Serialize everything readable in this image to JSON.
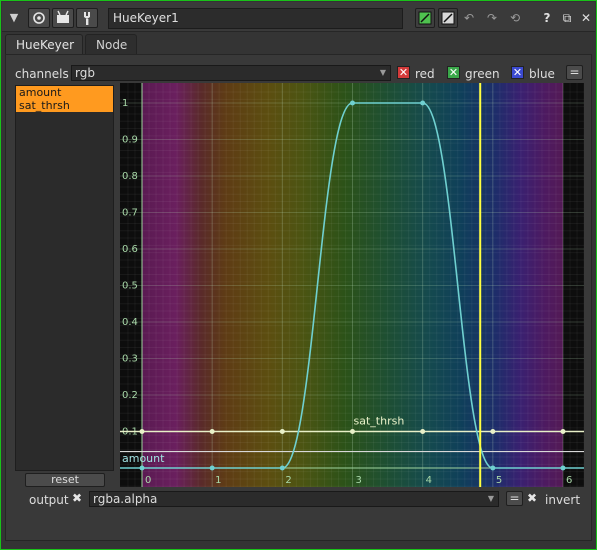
{
  "titlebar": {
    "node_name": "HueKeyer1",
    "help_label": "?",
    "float_label": "⧉",
    "close_label": "✕"
  },
  "tabs": [
    {
      "label": "HueKeyer",
      "active": true
    },
    {
      "label": "Node",
      "active": false
    }
  ],
  "channels": {
    "label": "channels",
    "value": "rgb",
    "red": {
      "label": "red",
      "checked": true,
      "color": "#d43a3a"
    },
    "green": {
      "label": "green",
      "checked": true,
      "color": "#3aa84a"
    },
    "blue": {
      "label": "blue",
      "checked": true,
      "color": "#3b4ad0"
    },
    "link_label": "="
  },
  "curves": [
    "amount",
    "sat_thrsh"
  ],
  "curve_highlight_color": "#ff9a1f",
  "reset_label": "reset",
  "output": {
    "label": "output",
    "value": "rgba.alpha",
    "link_label": "=",
    "invert_label": "invert",
    "invert_checked": false
  },
  "icons": [
    "collapse-triangle-icon",
    "settings-circle-icon",
    "viewer-icon",
    "wrench-icon",
    "node-color-icon",
    "node-swatch-icon",
    "undo-icon",
    "redo-icon",
    "revert-icon",
    "help-icon",
    "float-icon",
    "close-icon",
    "dropdown-arrow-icon"
  ],
  "chart_data": {
    "type": "line",
    "x_ticks": [
      "0",
      "1",
      "2",
      "3",
      "4",
      "5",
      "6"
    ],
    "y_ticks": [
      "0.1",
      "0.2",
      "0.3",
      "0.4",
      "0.5",
      "0.6",
      "0.7",
      "0.8",
      "0.9",
      "1"
    ],
    "xlim": [
      -0.1,
      6.3
    ],
    "ylim": [
      -0.05,
      1.04
    ],
    "grid": true,
    "playhead_x": 4.82,
    "series": [
      {
        "name": "amount",
        "color": "#6fd0d0",
        "points": [
          [
            0,
            0
          ],
          [
            1,
            0
          ],
          [
            2,
            0
          ],
          [
            3,
            1
          ],
          [
            4,
            1
          ],
          [
            5,
            0
          ],
          [
            6,
            0
          ]
        ]
      },
      {
        "name": "sat_thrsh",
        "color": "#e8f0c8",
        "points": [
          [
            0,
            0.1
          ],
          [
            1,
            0.1
          ],
          [
            2,
            0.1
          ],
          [
            3,
            0.1
          ],
          [
            4,
            0.1
          ],
          [
            5,
            0.1
          ],
          [
            6,
            0.1
          ]
        ]
      }
    ]
  }
}
